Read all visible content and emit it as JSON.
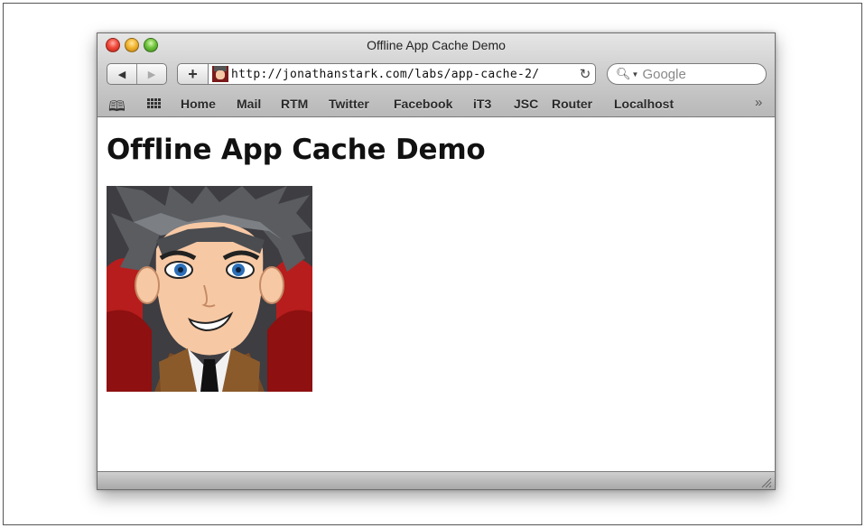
{
  "window": {
    "title": "Offline App Cache Demo"
  },
  "toolbar": {
    "back_icon": "back-arrow-icon",
    "forward_icon": "forward-arrow-icon",
    "add_label": "+",
    "url": "http://jonathanstark.com/labs/app-cache-2/",
    "reload_icon": "reload-icon",
    "search_placeholder": "Google"
  },
  "bookmarks": {
    "items": [
      "Home",
      "Mail",
      "RTM",
      "Twitter",
      "Facebook",
      "iT3",
      "JSC",
      "Router",
      "Localhost"
    ],
    "more_label": "»"
  },
  "page": {
    "heading": "Offline App Cache Demo",
    "image": "cartoon-avatar-image"
  },
  "colors": {
    "close": "#f0493a",
    "minimize": "#f3b531",
    "zoom": "#6fc43c"
  }
}
